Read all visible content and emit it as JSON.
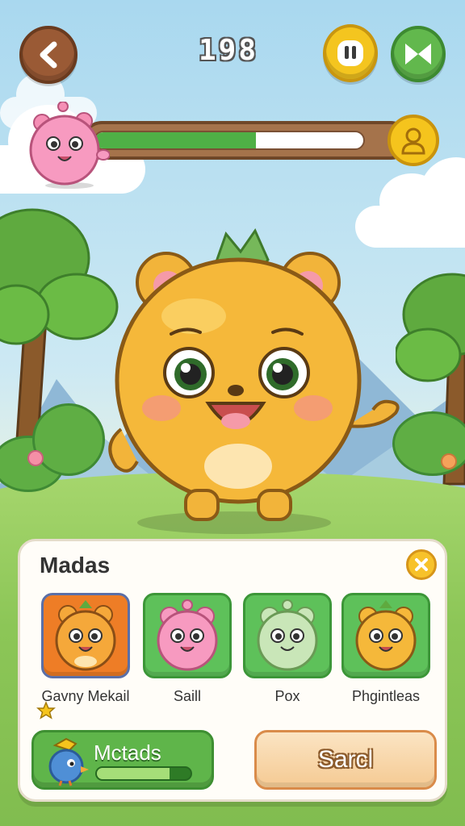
{
  "hud": {
    "score": "198",
    "progress_fraction": 0.6
  },
  "panel": {
    "title": "Madas",
    "characters": [
      {
        "name": "Gavny Mekail",
        "color": "#ee7d26",
        "selected": true
      },
      {
        "name": "Saill",
        "color": "#5ec15a",
        "selected": false
      },
      {
        "name": "Pox",
        "color": "#5ec15a",
        "selected": false
      },
      {
        "name": "Phgintleas",
        "color": "#5ec15a",
        "selected": false
      }
    ],
    "primary_button": {
      "label": "Mctads",
      "progress_fraction": 0.78
    },
    "secondary_button": {
      "label": "Sarcl"
    }
  },
  "colors": {
    "accent_green": "#5fb54a",
    "accent_yellow": "#f5c41d",
    "accent_brown": "#9a5a35"
  },
  "icons": {
    "back": "chevron-left-icon",
    "pause": "pause-icon",
    "fast_forward": "fast-forward-icon",
    "profile": "person-icon",
    "close": "close-icon",
    "star": "star-icon"
  }
}
